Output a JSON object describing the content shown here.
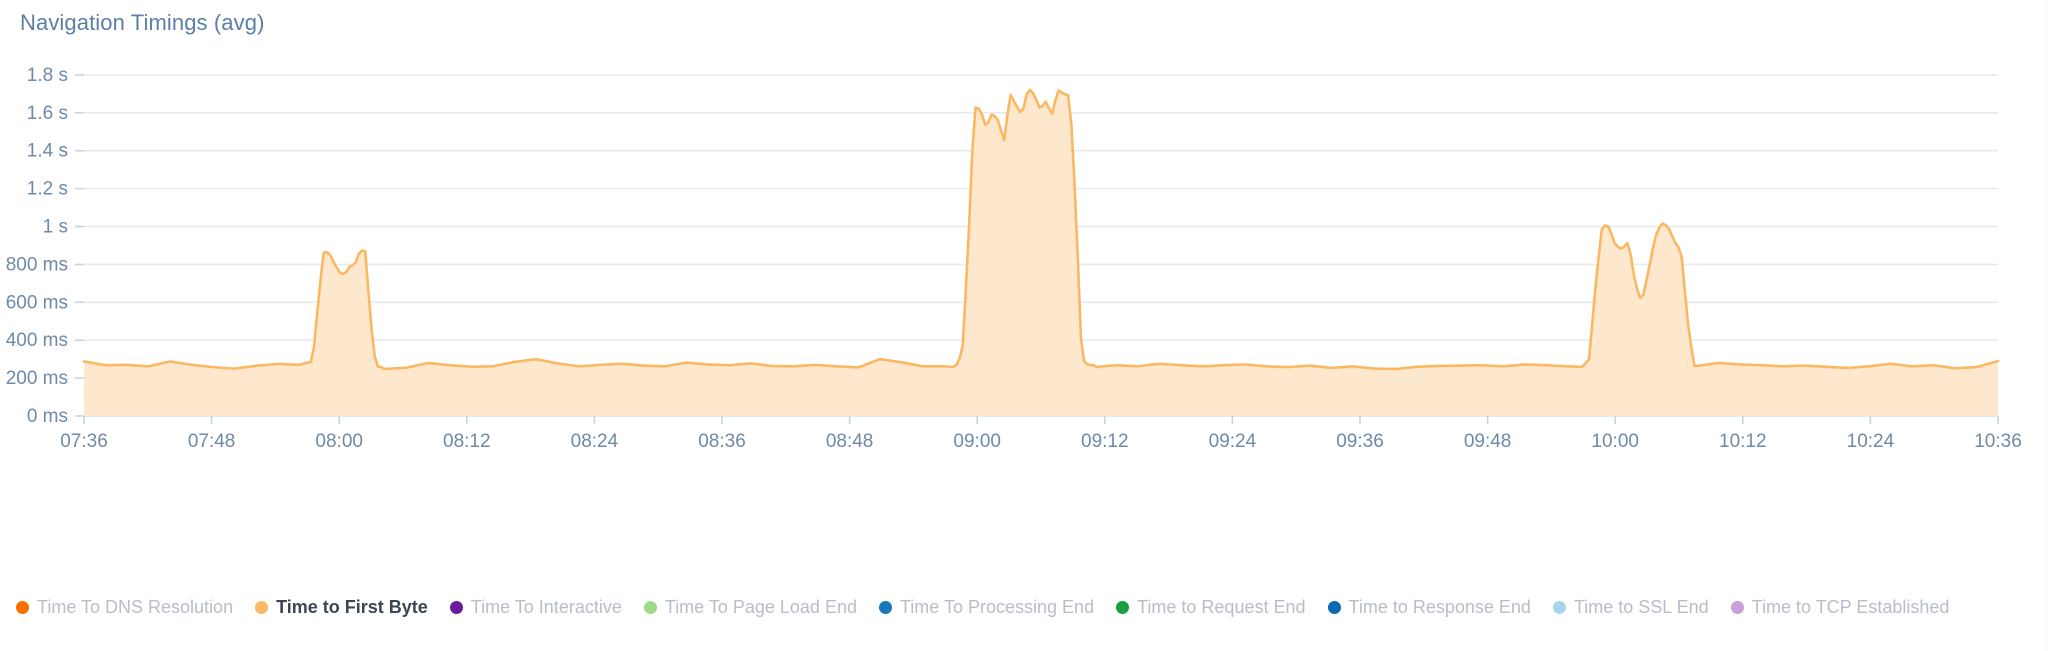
{
  "header": {
    "title": "Navigation Timings (avg)",
    "title_color": "#5b7fa6"
  },
  "legend": {
    "position": "bottom",
    "items": [
      {
        "label": "Time To DNS Resolution",
        "color": "#f96e00",
        "active": false
      },
      {
        "label": "Time to First Byte",
        "color": "#fbb863",
        "active": true
      },
      {
        "label": "Time To Interactive",
        "color": "#6a1b9a",
        "active": false
      },
      {
        "label": "Time To Page Load End",
        "color": "#9ddb8a",
        "active": false
      },
      {
        "label": "Time To Processing End",
        "color": "#1878b9",
        "active": false
      },
      {
        "label": "Time to Request End",
        "color": "#1b9e3e",
        "active": false
      },
      {
        "label": "Time to Response End",
        "color": "#0b69b4",
        "active": false
      },
      {
        "label": "Time to SSL End",
        "color": "#a9d5ea",
        "active": false
      },
      {
        "label": "Time to TCP Established",
        "color": "#c9a0d8",
        "active": false
      }
    ]
  },
  "chart_data": {
    "type": "area",
    "title": "Navigation Timings (avg)",
    "xlabel": "",
    "ylabel": "",
    "grid": true,
    "legend_position": "bottom",
    "ylim": [
      0,
      1900
    ],
    "y_unit": "ms",
    "y_ticks": [
      0,
      200,
      400,
      600,
      800,
      1000,
      1200,
      1400,
      1600,
      1800
    ],
    "y_tick_labels": [
      "0 ms",
      "200 ms",
      "400 ms",
      "600 ms",
      "800 ms",
      "1 s",
      "1.2 s",
      "1.4 s",
      "1.6 s",
      "1.8 s"
    ],
    "x_tick_labels": [
      "07:36",
      "07:48",
      "08:00",
      "08:12",
      "08:24",
      "08:36",
      "08:48",
      "09:00",
      "09:12",
      "09:24",
      "09:36",
      "09:48",
      "10:00",
      "10:12",
      "10:24",
      "10:36"
    ],
    "x_start": "07:36",
    "x_end": "10:36",
    "x_interval_minutes": 12,
    "series": [
      {
        "name": "Time to First Byte",
        "color": "#fbb863",
        "fill": "#fde8cd",
        "x": [
          "07:36",
          "07:38",
          "07:40",
          "07:42",
          "07:44",
          "07:46",
          "07:48",
          "07:50",
          "07:52",
          "07:54",
          "07:56",
          "07:58",
          "08:00",
          "08:02",
          "08:04",
          "08:06",
          "08:08",
          "08:10",
          "08:12",
          "08:14",
          "08:16",
          "08:18",
          "08:20",
          "08:22",
          "08:24",
          "08:26",
          "08:28",
          "08:30",
          "08:32",
          "08:34",
          "08:36",
          "08:38",
          "08:40",
          "08:42",
          "08:44",
          "08:46",
          "08:48",
          "08:50",
          "08:52",
          "08:54",
          "08:56",
          "08:58",
          "09:00",
          "09:02",
          "09:04",
          "09:06",
          "09:08",
          "09:10",
          "09:12",
          "09:14",
          "09:16",
          "09:18",
          "09:20",
          "09:22",
          "09:24",
          "09:26",
          "09:28",
          "09:30",
          "09:32",
          "09:34",
          "09:36",
          "09:38",
          "09:40",
          "09:42",
          "09:44",
          "09:46",
          "09:48",
          "09:50",
          "09:52",
          "09:54",
          "09:56",
          "09:58",
          "10:00",
          "10:02",
          "10:04",
          "10:06",
          "10:08",
          "10:10",
          "10:12",
          "10:14",
          "10:16",
          "10:18",
          "10:20",
          "10:22",
          "10:24",
          "10:26",
          "10:28",
          "10:30",
          "10:32",
          "10:34"
        ],
        "values": [
          288,
          268,
          270,
          262,
          288,
          270,
          258,
          250,
          265,
          275,
          270,
          300,
          290,
          258,
          248,
          255,
          280,
          268,
          260,
          262,
          285,
          300,
          278,
          262,
          270,
          276,
          266,
          262,
          282,
          272,
          268,
          278,
          264,
          262,
          270,
          262,
          256,
          300,
          284,
          262,
          262,
          254,
          250,
          262,
          268,
          252,
          242,
          258,
          268,
          262,
          276,
          268,
          262,
          268,
          272,
          262,
          258,
          266,
          254,
          262,
          250,
          248,
          260,
          264,
          266,
          268,
          262,
          272,
          268,
          262,
          258,
          250,
          262,
          258,
          266,
          264,
          280,
          272,
          268,
          262,
          266,
          260,
          254,
          262,
          276,
          262,
          268,
          252,
          258,
          290
        ],
        "peaks": [
          {
            "x": "07:58",
            "approx_peak_ms": 870,
            "shape": "spike-cluster",
            "description": "Rise to ~865 ms, dip to ~745 ms, second peak ~875 ms, then fall to ~255 ms"
          },
          {
            "x": "09:00",
            "approx_peak_ms": 1730,
            "shape": "spike-cluster",
            "description": "Rise to ~1630 ms, oscillate 1450-1730 ms, sustained plateau, then drop to ~270 ms near 09:11"
          },
          {
            "x": "10:00",
            "approx_peak_ms": 1020,
            "shape": "spike-cluster",
            "description": "Rise to ~1010 ms, dip to ~600 ms, second peak ~1020 ms, then fall to ~245 ms near 10:11"
          }
        ],
        "baseline_range_ms": [
          240,
          300
        ]
      }
    ]
  }
}
